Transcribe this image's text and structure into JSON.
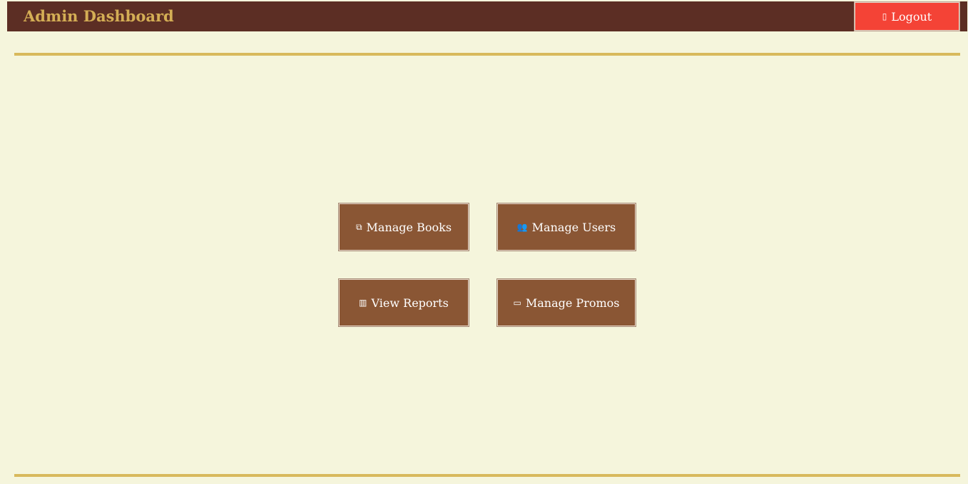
{
  "header": {
    "title": "Admin Dashboard",
    "logout": {
      "label": "Logout",
      "icon": "door-icon",
      "glyph": "▯"
    }
  },
  "actions": [
    {
      "label": "Manage Books",
      "icon": "books-icon",
      "glyph": "⧉"
    },
    {
      "label": "Manage Users",
      "icon": "users-icon",
      "glyph": "👥"
    },
    {
      "label": "View Reports",
      "icon": "chart-icon",
      "glyph": "▥"
    },
    {
      "label": "Manage Promos",
      "icon": "ticket-icon",
      "glyph": "▭"
    }
  ],
  "colors": {
    "background": "#f5f5dc",
    "header_bg": "#5c2e24",
    "title": "#d4ae55",
    "rule": "#d8b95c",
    "logout_bg": "#f44336",
    "action_bg": "#8a5634"
  }
}
